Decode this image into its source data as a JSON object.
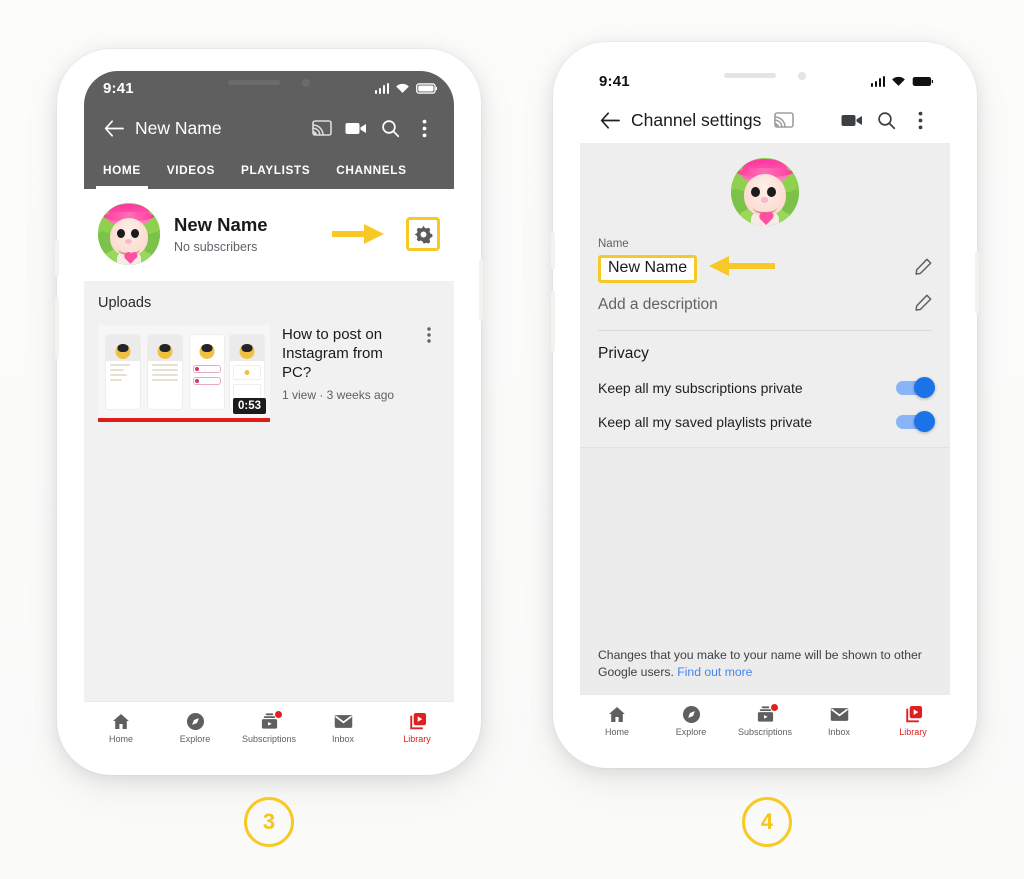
{
  "steps": [
    {
      "number": "3"
    },
    {
      "number": "4"
    }
  ],
  "phone1": {
    "status": {
      "time": "9:41",
      "signal_icon": "cellular-bars-icon",
      "wifi_icon": "wifi-icon",
      "battery_icon": "battery-full-icon"
    },
    "appbar": {
      "back_icon": "back-arrow-icon",
      "title": "New Name",
      "cast_icon": "cast-icon",
      "camera_icon": "video-camera-icon",
      "search_icon": "search-icon",
      "more_icon": "more-vertical-icon"
    },
    "tabs": [
      {
        "label": "HOME",
        "active": true
      },
      {
        "label": "VIDEOS",
        "active": false
      },
      {
        "label": "PLAYLISTS",
        "active": false
      },
      {
        "label": "CHANNELS",
        "active": false
      }
    ],
    "channel": {
      "avatar_name": "channel-avatar",
      "name": "New Name",
      "subscribers": "No subscribers",
      "arrow_icon": "annotation-arrow-right",
      "gear_icon": "gear-icon"
    },
    "uploads": {
      "section_title": "Uploads",
      "video": {
        "title": "How to post on Instagram from PC?",
        "meta": "1 view · 3 weeks ago",
        "duration": "0:53",
        "kebab_icon": "more-vertical-icon"
      }
    },
    "bottom_nav": [
      {
        "label": "Home",
        "icon": "home-icon",
        "active": false,
        "badge": false
      },
      {
        "label": "Explore",
        "icon": "compass-icon",
        "active": false,
        "badge": false
      },
      {
        "label": "Subscriptions",
        "icon": "subscriptions-icon",
        "active": false,
        "badge": true
      },
      {
        "label": "Inbox",
        "icon": "envelope-icon",
        "active": false,
        "badge": false
      },
      {
        "label": "Library",
        "icon": "library-icon",
        "active": true,
        "badge": false
      }
    ]
  },
  "phone2": {
    "status": {
      "time": "9:41",
      "signal_icon": "cellular-bars-icon",
      "wifi_icon": "wifi-icon",
      "battery_icon": "battery-full-icon"
    },
    "appbar": {
      "back_icon": "back-arrow-icon",
      "title": "Channel settings",
      "cast_icon": "cast-icon",
      "camera_icon": "video-camera-icon",
      "search_icon": "search-icon",
      "more_icon": "more-vertical-icon"
    },
    "profile": {
      "avatar_name": "profile-avatar"
    },
    "name_field": {
      "label": "Name",
      "value": "New Name",
      "edit_icon": "pencil-icon",
      "arrow_icon": "annotation-arrow-left"
    },
    "description_field": {
      "placeholder": "Add a description",
      "edit_icon": "pencil-icon"
    },
    "privacy": {
      "title": "Privacy",
      "rows": [
        {
          "label": "Keep all my subscriptions private",
          "on": true
        },
        {
          "label": "Keep all my saved playlists private",
          "on": true
        }
      ]
    },
    "footnote": {
      "text": "Changes that you make to your name will be shown to other Google users. ",
      "link": "Find out more"
    },
    "bottom_nav": [
      {
        "label": "Home",
        "icon": "home-icon",
        "active": false,
        "badge": false
      },
      {
        "label": "Explore",
        "icon": "compass-icon",
        "active": false,
        "badge": false
      },
      {
        "label": "Subscriptions",
        "icon": "subscriptions-icon",
        "active": false,
        "badge": true
      },
      {
        "label": "Inbox",
        "icon": "envelope-icon",
        "active": false,
        "badge": false
      },
      {
        "label": "Library",
        "icon": "library-icon",
        "active": true,
        "badge": false
      }
    ]
  },
  "colors": {
    "annotation_yellow": "#f8c826",
    "appbar_gray": "#5f5f5f",
    "youtube_red": "#e02020",
    "toggle_on": "#1a73e8",
    "link_blue": "#4285f4"
  }
}
